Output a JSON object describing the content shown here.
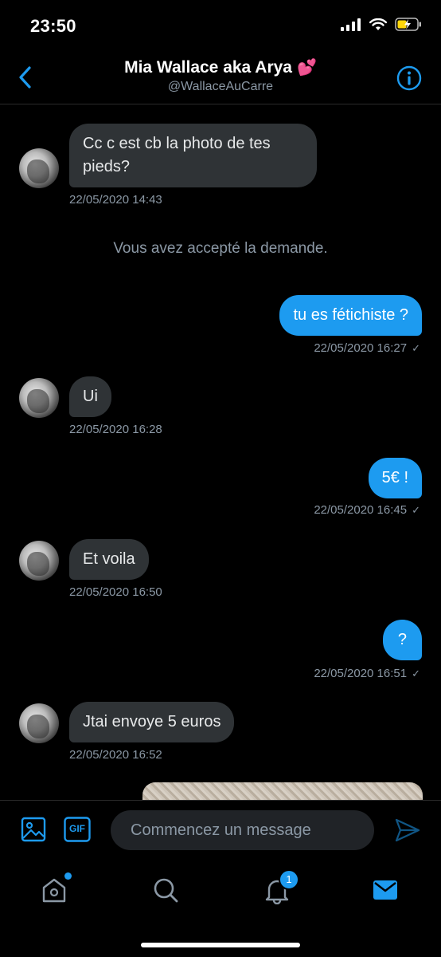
{
  "status_bar": {
    "time": "23:50"
  },
  "header": {
    "title": "Mia Wallace aka Arya",
    "title_emoji": "💕",
    "handle": "@WallaceAuCarre",
    "back_icon": "chevron-left-icon",
    "info_icon": "info-icon"
  },
  "messages": [
    {
      "dir": "in",
      "lines": [
        "Cc c est cb la photo de tes",
        "pieds?"
      ],
      "time": "22/05/2020 14:43"
    },
    {
      "notice": "Vous avez accepté la demande."
    },
    {
      "dir": "out",
      "text": "tu es fétichiste ?",
      "time": "22/05/2020 16:27",
      "read": true
    },
    {
      "dir": "in",
      "text": "Ui",
      "time": "22/05/2020 16:28"
    },
    {
      "dir": "out",
      "text": "5€ !",
      "time": "22/05/2020 16:45",
      "read": true
    },
    {
      "dir": "in",
      "text": "Et voila",
      "time": "22/05/2020 16:50"
    },
    {
      "dir": "out",
      "text": "?",
      "time": "22/05/2020 16:51",
      "read": true
    },
    {
      "dir": "in",
      "text": "Jtai envoye 5 euros",
      "time": "22/05/2020 16:52"
    }
  ],
  "composer": {
    "placeholder": "Commencez un message",
    "gif_label": "GIF"
  },
  "tabbar": {
    "notifications_badge": "1"
  },
  "colors": {
    "accent": "#1d9bf0",
    "bubble_in": "#2f3336",
    "muted": "#8b98a5"
  }
}
